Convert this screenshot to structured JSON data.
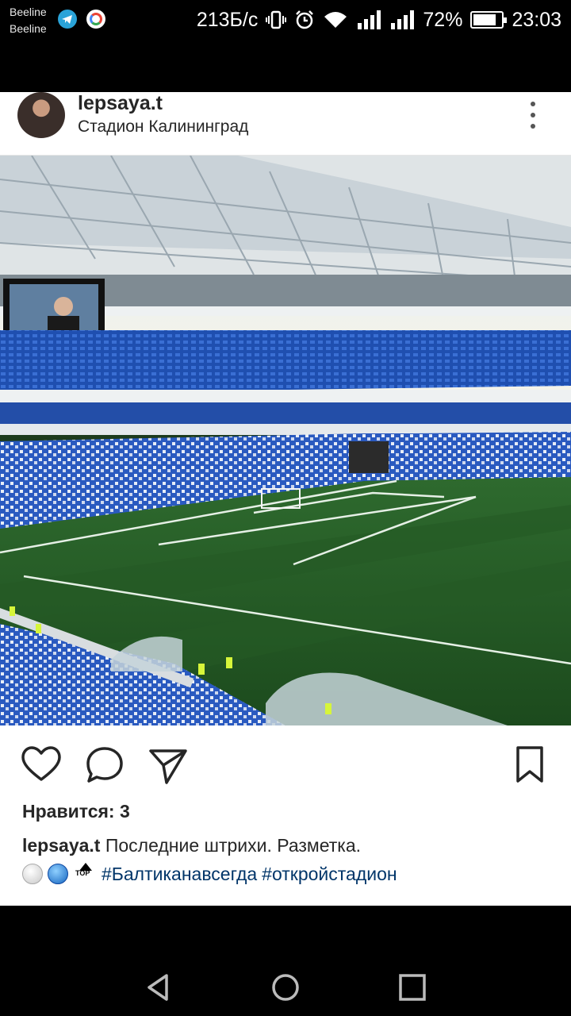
{
  "status_bar": {
    "carrier_1": "Beeline",
    "carrier_2": "Beeline",
    "speed": "213Б/с",
    "battery_percent": "72%",
    "time": "23:03",
    "icons": [
      "telegram-icon",
      "google-icon",
      "vibrate-icon",
      "alarm-icon",
      "wifi-icon",
      "signal-icon",
      "signal-icon",
      "battery-icon"
    ]
  },
  "post": {
    "username": "lepsaya.t",
    "location": "Стадион Калининград",
    "likes_text": "Нравится: 3",
    "caption_user": "lepsaya.t",
    "caption_text": " Последние штрихи. Разметка.",
    "hashtag_1": "#Балтиканавсегда",
    "hashtag_2": "#откройстадион",
    "top_emoji_text": "TOP"
  },
  "colors": {
    "text": "#262626",
    "hashtag": "#003569",
    "seat_blue": "#1f4fb0",
    "pitch_green": "#2c5a2a"
  },
  "navbar": {
    "icons": [
      "back-icon",
      "home-icon",
      "recents-icon"
    ]
  }
}
